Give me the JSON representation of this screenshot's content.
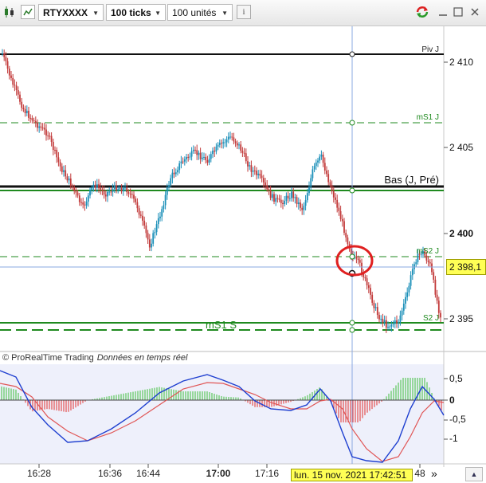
{
  "toolbar": {
    "instrument": "RTYXXXX",
    "period": "100 ticks",
    "units": "100 unités",
    "icons": [
      "candle-chart-icon",
      "chart-type-icon",
      "info-icon",
      "refresh-icon",
      "minimize-icon",
      "close-icon"
    ]
  },
  "price_axis": {
    "labels": [
      "2 410",
      "2 405",
      "2 400",
      "2 395"
    ],
    "cursor_value": "2 398,1"
  },
  "osc_axis": {
    "labels": [
      "0,5",
      "0",
      "-0,5",
      "-1"
    ]
  },
  "time_axis": {
    "labels": [
      "16:28",
      "16:36",
      "16:44",
      "17:00",
      "17:16",
      "48"
    ],
    "cursor_label": "lun. 15 nov. 2021 17:42:51",
    "scroll_label": "»"
  },
  "status": {
    "brand": "© ProRealTime Trading",
    "feed": "Données en temps réel"
  },
  "levels": {
    "piv": "Piv J",
    "ms1j": "mS1 J",
    "bas": "Bas (J, Pré)",
    "ms2j": "mS2 J",
    "s2j": "S2 J",
    "ms1s": "mS1 S"
  },
  "colors": {
    "bull": "#1a8fb8",
    "bear": "#c23a3a",
    "level_green": "#1f8a1f",
    "cursor": "#8aa8e0",
    "osc_blue": "#1e3fd0",
    "osc_red": "#e05555",
    "hist_green": "#5cc65c",
    "hist_red": "#e35050"
  }
}
